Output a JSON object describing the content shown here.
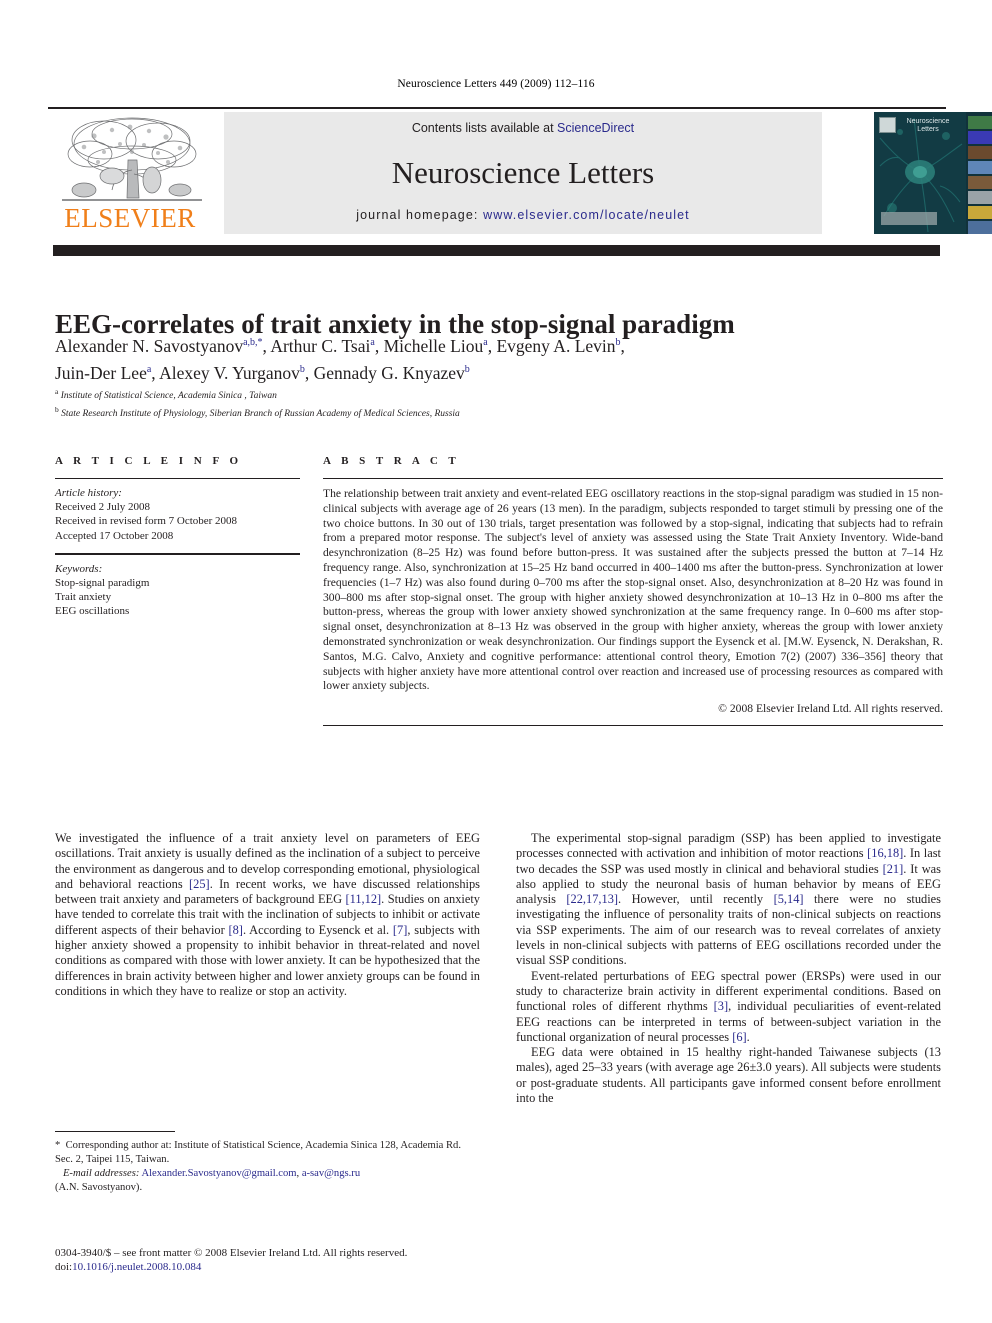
{
  "running_head": "Neuroscience Letters 449 (2009) 112–116",
  "banner": {
    "publisher_wordmark": "ELSEVIER",
    "contents_prefix": "Contents lists available at ",
    "contents_link": "ScienceDirect",
    "journal_name": "Neuroscience Letters",
    "homepage_prefix": "journal homepage: ",
    "homepage_url": "www.elsevier.com/locate/neulet",
    "cover_title": "Neuroscience Letters",
    "accent_link_color": "#2a2a8c",
    "elsevier_orange": "#f07f1a",
    "cover_background": "#0d2b33",
    "banner_background": "#e9e9e9"
  },
  "article": {
    "title": "EEG-correlates of trait anxiety in the stop-signal paradigm",
    "authors_line_1": "Alexander N. Savostyanov",
    "authors_line_2": "Juin-Der Lee",
    "affiliation_a": "Institute of Statistical Science, Academia Sinica , Taiwan",
    "affiliation_b": "State Research Institute of Physiology, Siberian Branch of Russian Academy of Medical Sciences, Russia"
  },
  "article_info": {
    "heading": "A R T I C L E  I N F O",
    "history_label": "Article history:",
    "received": "Received 2 July 2008",
    "revised": "Received in revised form 7 October 2008",
    "accepted": "Accepted 17 October 2008",
    "keywords_label": "Keywords:",
    "keywords": [
      "Stop-signal paradigm",
      "Trait anxiety",
      "EEG oscillations"
    ]
  },
  "abstract": {
    "heading": "A B S T R A C T",
    "text": "The relationship between trait anxiety and event-related EEG oscillatory reactions in the stop-signal paradigm was studied in 15 non-clinical subjects with average age of 26 years (13 men). In the paradigm, subjects responded to target stimuli by pressing one of the two choice buttons. In 30 out of 130 trials, target presentation was followed by a stop-signal, indicating that subjects had to refrain from a prepared motor response. The subject's level of anxiety was assessed using the State Trait Anxiety Inventory. Wide-band desynchronization (8–25 Hz) was found before button-press. It was sustained after the subjects pressed the button at 7–14 Hz frequency range. Also, synchronization at 15–25 Hz band occurred in 400–1400 ms after the button-press. Synchronization at lower frequencies (1–7 Hz) was also found during 0–700 ms after the stop-signal onset. Also, desynchronization at 8–20 Hz was found in 300–800 ms after stop-signal onset. The group with higher anxiety showed desynchronization at 10–13 Hz in 0–800 ms after the button-press, whereas the group with lower anxiety showed synchronization at the same frequency range. In 0–600 ms after stop-signal onset, desynchronization at 8–13 Hz was observed in the group with higher anxiety, whereas the group with lower anxiety demonstrated synchronization or weak desynchronization. Our findings support the Eysenck et al. [M.W. Eysenck, N. Derakshan, R. Santos, M.G. Calvo, Anxiety and cognitive performance: attentional control theory, Emotion 7(2) (2007) 336–356] theory that subjects with higher anxiety have more attentional control over reaction and increased use of processing resources as compared with lower anxiety subjects.",
    "copyright": "© 2008 Elsevier Ireland Ltd. All rights reserved."
  },
  "body": {
    "left_paragraph_1_a": "We investigated the influence of a trait anxiety level on parameters of EEG oscillations. Trait anxiety is usually defined as the inclination of a subject to perceive the environment as dangerous and to develop corresponding emotional, physiological and behavioral reactions ",
    "ref_25": "[25]",
    "left_paragraph_1_b": ". In recent works, we have discussed relationships between trait anxiety and parameters of background EEG ",
    "ref_11_12": "[11,12]",
    "left_paragraph_1_c": ". Studies on anxiety have tended to correlate this trait with the inclination of subjects to inhibit or activate different aspects of their behavior ",
    "ref_8": "[8]",
    "left_paragraph_1_d": ". According to Eysenck et al. ",
    "ref_7": "[7]",
    "left_paragraph_1_e": ", subjects with higher anxiety showed a propensity to inhibit behavior in threat-related and novel conditions as compared with those with lower anxiety. It can be hypothesized that the differences in brain activity between higher and lower anxiety groups can be found in conditions in which they have to realize or stop an activity.",
    "right_paragraph_1_a": "The experimental stop-signal paradigm (SSP) has been applied to investigate processes connected with activation and inhibition of motor reactions ",
    "ref_16_18": "[16,18]",
    "right_paragraph_1_b": ". In last two decades the SSP was used mostly in clinical and behavioral studies ",
    "ref_21": "[21]",
    "right_paragraph_1_c": ". It was also applied to study the neuronal basis of human behavior by means of EEG analysis ",
    "ref_22_17_13": "[22,17,13]",
    "right_paragraph_1_d": ". However, until recently ",
    "ref_5_14": "[5,14]",
    "right_paragraph_1_e": " there were no studies investigating the influence of personality traits of non-clinical subjects on reactions via SSP experiments. The aim of our research was to reveal correlates of anxiety levels in non-clinical subjects with patterns of EEG oscillations recorded under the visual SSP conditions.",
    "right_paragraph_2_a": "Event-related perturbations of EEG spectral power (ERSPs) were used in our study to characterize brain activity in different experimental conditions. Based on functional roles of different rhythms ",
    "ref_3": "[3]",
    "right_paragraph_2_b": ", individual peculiarities of event-related EEG reactions can be interpreted in terms of between-subject variation in the functional organization of neural processes ",
    "ref_6": "[6]",
    "right_paragraph_2_c": ".",
    "right_paragraph_3": "EEG data were obtained in 15 healthy right-handed Taiwanese subjects (13 males), aged 25–33 years (with average age 26±3.0 years). All subjects were students or post-graduate students. All participants gave informed consent before enrollment into the"
  },
  "footnote": {
    "star": "*",
    "corresponding": "Corresponding author at: Institute of Statistical Science, Academia Sinica 128, Academia Rd. Sec. 2, Taipei 115, Taiwan.",
    "email_label": "E-mail addresses:",
    "email_1": "Alexander.Savostyanov@gmail.com",
    "email_2": "a-sav@ngs.ru",
    "email_owner": "(A.N. Savostyanov)."
  },
  "issn": {
    "line_1": "0304-3940/$ – see front matter © 2008 Elsevier Ireland Ltd. All rights reserved.",
    "doi_label": "doi:",
    "doi_value": "10.1016/j.neulet.2008.10.084"
  }
}
